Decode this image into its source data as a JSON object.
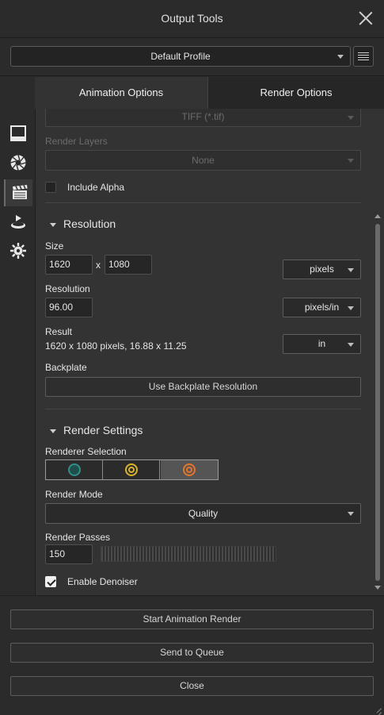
{
  "window": {
    "title": "Output Tools"
  },
  "profile": {
    "selected": "Default Profile"
  },
  "tabs": [
    {
      "label": "Animation Options",
      "active": false
    },
    {
      "label": "Render Options",
      "active": true
    }
  ],
  "sidebar": {
    "items": [
      {
        "icon": "frame-icon",
        "active": false
      },
      {
        "icon": "aperture-icon",
        "active": false
      },
      {
        "icon": "clapperboard-icon",
        "active": true
      },
      {
        "icon": "turntable-icon",
        "active": false
      },
      {
        "icon": "sun-gear-icon",
        "active": false
      }
    ]
  },
  "render": {
    "format_value": "TIFF (*.tif)",
    "layers_label": "Render Layers",
    "layers_value": "None",
    "include_alpha_label": "Include Alpha",
    "include_alpha_checked": false
  },
  "resolution": {
    "section_title": "Resolution",
    "size_label": "Size",
    "width": "1620",
    "x_sep": "x",
    "height": "1080",
    "size_unit": "pixels",
    "resolution_label": "Resolution",
    "dpi": "96.00",
    "dpi_unit": "pixels/in",
    "result_label": "Result",
    "result_text": "1620 x 1080 pixels, 16.88 x 11.25",
    "result_unit": "in",
    "backplate_label": "Backplate",
    "backplate_button": "Use Backplate Resolution"
  },
  "render_settings": {
    "section_title": "Render Settings",
    "renderer_label": "Renderer Selection",
    "renderers": [
      {
        "icon": "teal-ring-icon",
        "color": "#2f8f86",
        "active": false
      },
      {
        "icon": "gold-ring-icon",
        "color": "#d9b12a",
        "active": false
      },
      {
        "icon": "orange-ring-icon",
        "color": "#e5742c",
        "active": true
      }
    ],
    "mode_label": "Render Mode",
    "mode_value": "Quality",
    "passes_label": "Render Passes",
    "passes_value": "150",
    "denoiser_label": "Enable Denoiser",
    "denoiser_checked": true
  },
  "footer": {
    "start_button": "Start Animation Render",
    "queue_button": "Send to Queue",
    "close_button": "Close"
  }
}
